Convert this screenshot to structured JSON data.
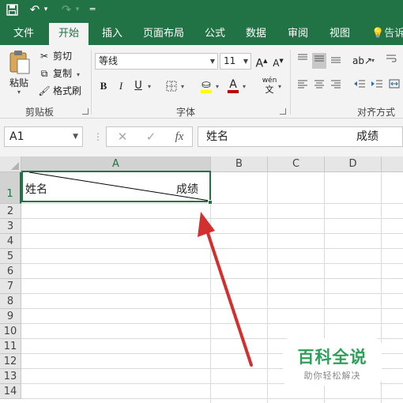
{
  "titlebar": {
    "save_icon": "save-icon",
    "undo_icon": "undo-icon",
    "redo_icon": "redo-icon",
    "customize_icon": "customize-quick-access-icon"
  },
  "tabs": [
    {
      "label": "文件"
    },
    {
      "label": "开始"
    },
    {
      "label": "插入"
    },
    {
      "label": "页面布局"
    },
    {
      "label": "公式"
    },
    {
      "label": "数据"
    },
    {
      "label": "审阅"
    },
    {
      "label": "视图"
    }
  ],
  "tell_me": "告诉",
  "clipboard": {
    "paste_label": "粘贴",
    "cut_label": "剪切",
    "copy_label": "复制",
    "format_painter_label": "格式刷",
    "group_label": "剪贴板"
  },
  "font": {
    "font_name": "等线",
    "font_size": "11",
    "bold": "B",
    "italic": "I",
    "underline": "U",
    "wen": "wén",
    "wen_char": "文",
    "font_color_letter": "A",
    "grow_letter": "A",
    "shrink_letter": "A",
    "group_label": "字体",
    "fill_color": "#ffff00",
    "font_color": "#c00000"
  },
  "alignment": {
    "group_label": "对齐方式"
  },
  "formula_bar": {
    "name_box": "A1",
    "more": "⋮",
    "fx": "fx",
    "content_left": "姓名",
    "content_right": "成绩"
  },
  "columns": [
    "A",
    "B",
    "C",
    "D"
  ],
  "rows": [
    "1",
    "2",
    "3",
    "4",
    "5",
    "6",
    "7",
    "8",
    "9",
    "10",
    "11",
    "12",
    "13",
    "14"
  ],
  "cell_a1": {
    "left_text": "姓名",
    "right_text": "成绩"
  },
  "watermark": {
    "title": "百科全说",
    "subtitle": "助你轻松解决"
  },
  "colors": {
    "accent": "#217346",
    "arrow": "#d32f2f"
  }
}
